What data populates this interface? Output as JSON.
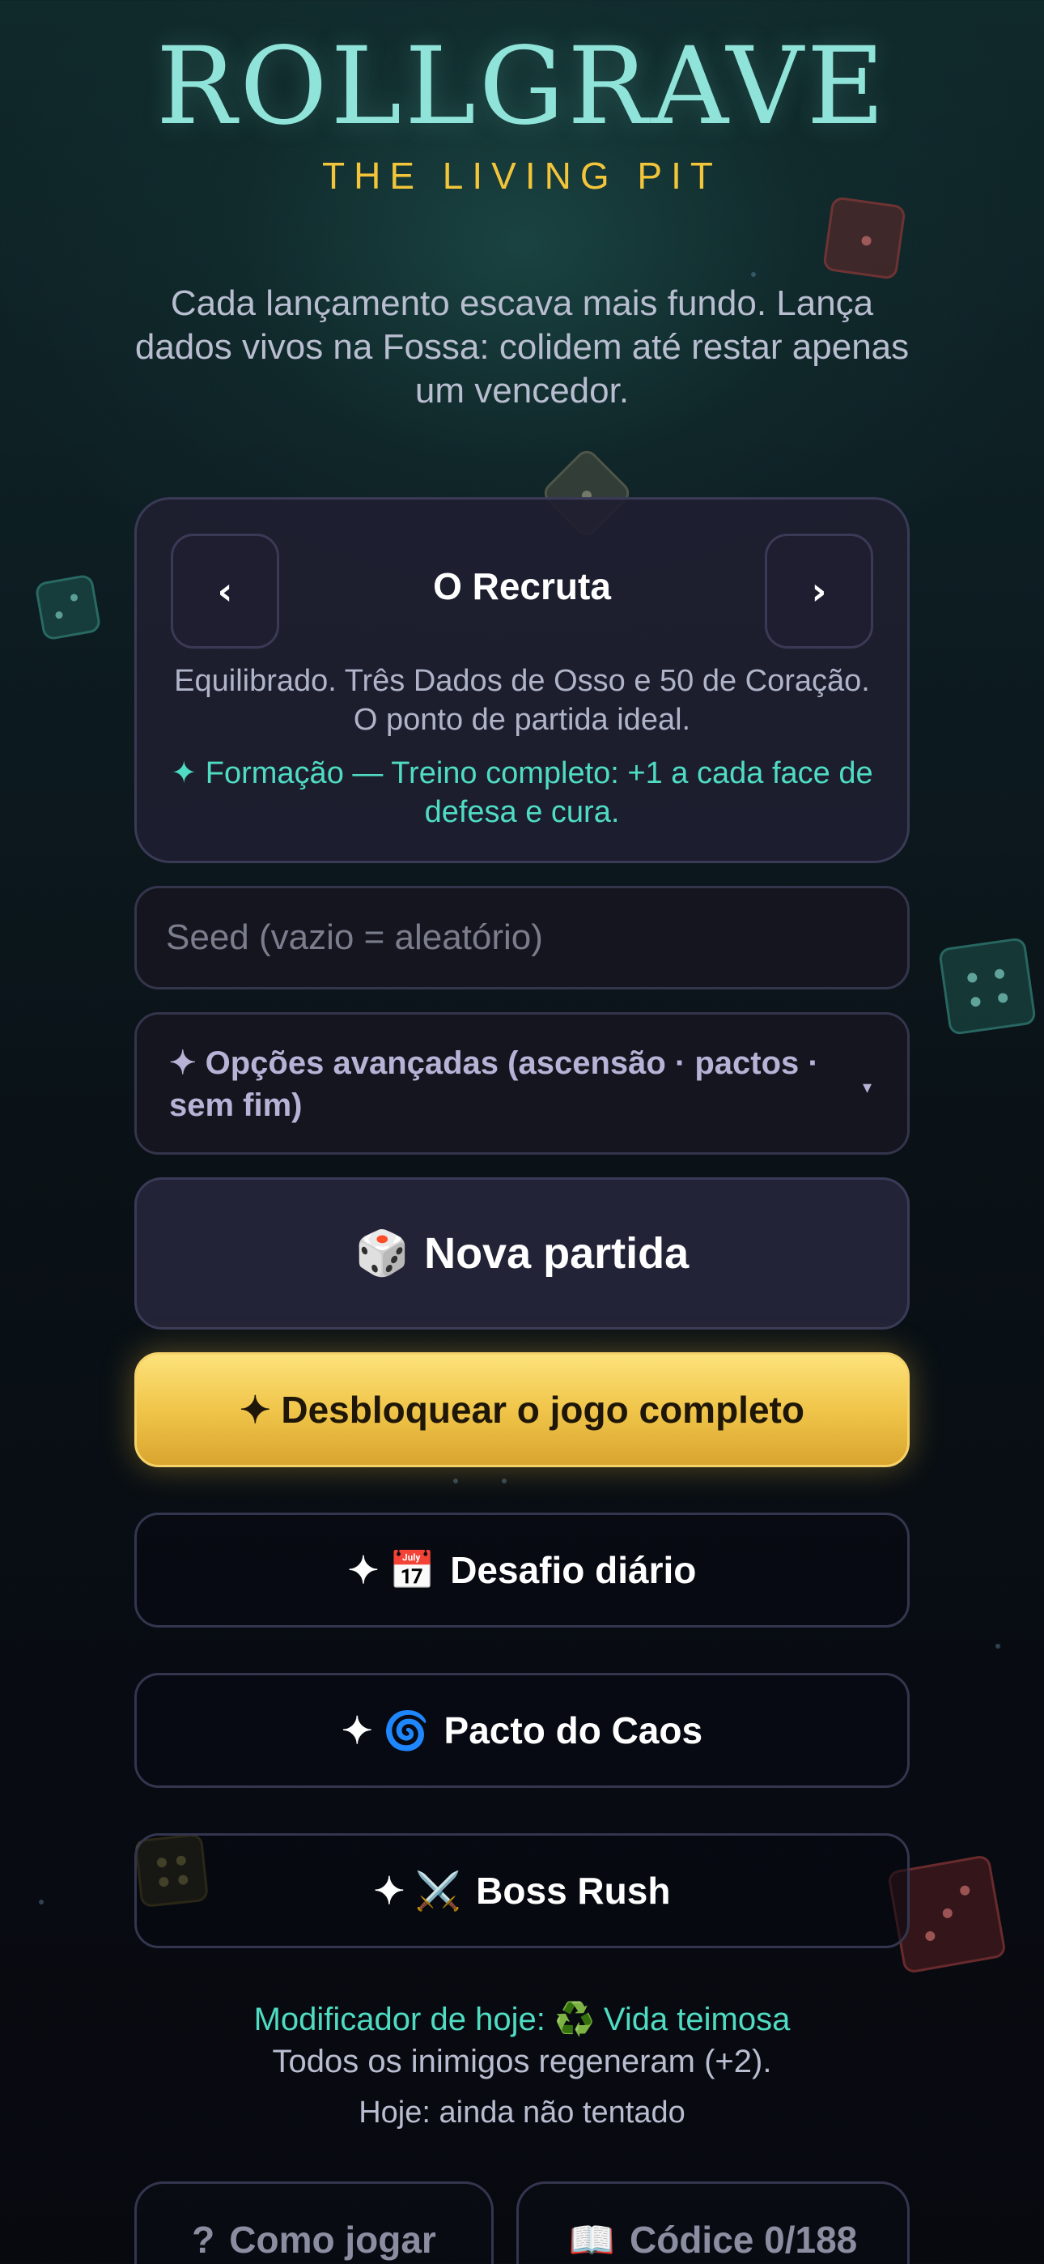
{
  "header": {
    "title": "ROLLGRAVE",
    "subtitle": "THE LIVING PIT"
  },
  "intro": "Cada lançamento escava mais fundo. Lança dados vivos na Fossa: colidem até restar apenas um vencedor.",
  "character": {
    "prev_label": "‹",
    "next_label": "›",
    "name": "O Recruta",
    "description": "Equilibrado. Três Dados de Osso e 50 de Coração. O ponto de partida ideal.",
    "trait": "✦ Formação — Treino completo: +1 a cada face de defesa e cura."
  },
  "seed": {
    "placeholder": "Seed (vazio = aleatório)",
    "value": ""
  },
  "advanced": {
    "label": "✦ Opções avançadas (ascensão · pactos · sem fim)",
    "caret": "▾"
  },
  "buttons": {
    "new_game_icon": "🎲",
    "new_game": "Nova partida",
    "unlock": "✦ Desbloquear o jogo completo",
    "daily_icon": "✦ 📅",
    "daily": "Desafio diário",
    "chaos_icon": "✦ 🌀",
    "chaos": "Pacto do Caos",
    "boss_icon": "✦ ⚔️",
    "boss": "Boss Rush"
  },
  "daily_info": {
    "modifier": "Modificador de hoje: ♻️ Vida teimosa",
    "modifier_desc": "Todos os inimigos regeneram (+2).",
    "status": "Hoje: ainda não tentado"
  },
  "footer": {
    "howto_icon": "?",
    "howto": "Como jogar",
    "codex_icon": "📖",
    "codex": "Códice 0/188"
  },
  "colors": {
    "title": "#8fe3d8",
    "subtitle": "#f2c53a",
    "accent_teal": "#4fdcc3",
    "gold": "#f0c54a"
  }
}
